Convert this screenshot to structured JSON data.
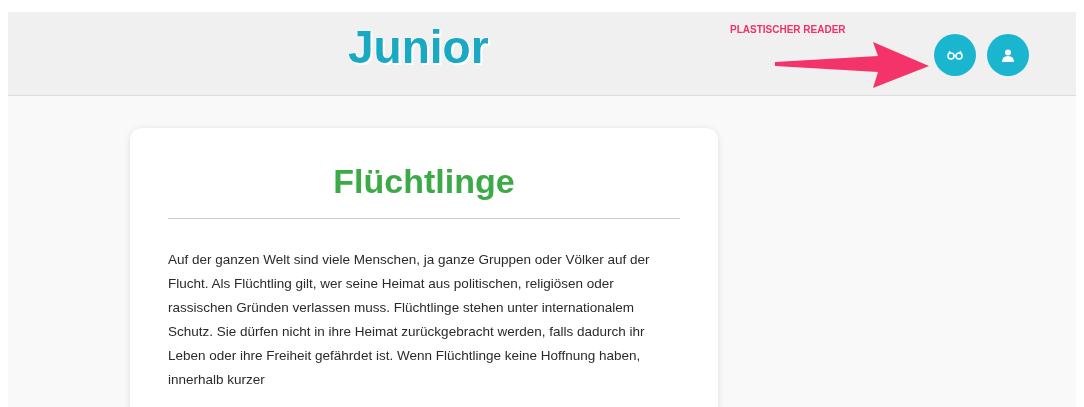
{
  "header": {
    "logo": "Junior",
    "annotation": "PLASTISCHER READER",
    "buttons": [
      {
        "kind": "reader"
      },
      {
        "kind": "user"
      }
    ]
  },
  "article": {
    "title": "Flüchtlinge",
    "paragraph": "Auf der ganzen Welt sind viele Menschen, ja ganze Gruppen oder Völker auf der Flucht. Als Flüchtling gilt, wer seine Heimat aus politischen, religiösen oder rassischen Gründen verlassen muss. Flüchtlinge stehen unter internationalem Schutz. Sie dürfen nicht in ihre Heimat zurückgebracht werden, falls dadurch ihr Leben oder ihre Freiheit gefährdet ist. Wenn Flüchtlinge keine Hoffnung haben, innerhalb kurzer"
  }
}
